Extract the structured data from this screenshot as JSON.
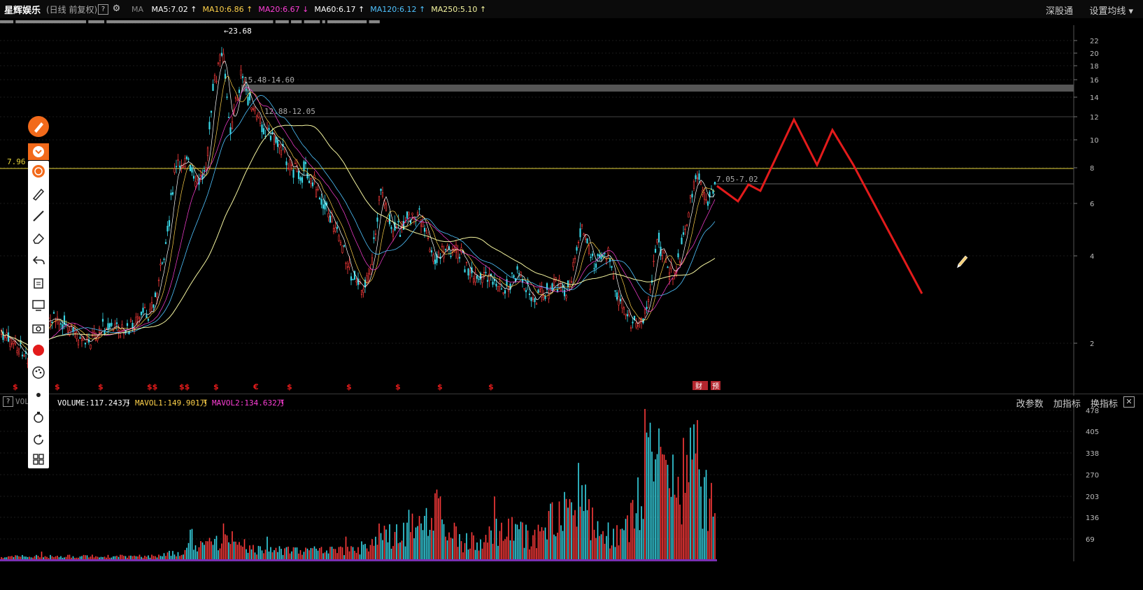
{
  "header": {
    "stock_name": "星辉娱乐",
    "subtitle": "(日线 前复权)",
    "help": "?",
    "ma_label": "MA",
    "ma_values": [
      {
        "text": "MA5:7.02",
        "arrow": "↑",
        "color": "#ffffff"
      },
      {
        "text": "MA10:6.86",
        "arrow": "↑",
        "color": "#ffd24a"
      },
      {
        "text": "MA20:6.67",
        "arrow": "↓",
        "color": "#ff3fd8"
      },
      {
        "text": "MA60:6.17",
        "arrow": "↑",
        "color": "#ffffff"
      },
      {
        "text": "MA120:6.12",
        "arrow": "↑",
        "color": "#4fc3ff"
      },
      {
        "text": "MA250:5.10",
        "arrow": "↑",
        "color": "#f5f5a0"
      }
    ],
    "shen_gu_tong": "深股通",
    "settings": "设置均线",
    "settings_arrow": "▾"
  },
  "ticker_text": "■■■■■ ■■■■■■■■■■■■■■■■■■■■■■■■■■■ ■■■■■■ ■■■■■■■■■■■■■■■■■■■■■■■■■■■■■■■■■■■■■■■■■■■■■■■■■■■■■■■■■■■■■■■■ ■■■■■ ■■■■ ■■■■■■ ■ ■■■■■■■■■■■■■■■ ■■■■",
  "price_chart": {
    "peak_label": "←23.68",
    "zone1_label": "15.48-14.60",
    "zone2_label": "12.88-12.05",
    "zone3_label": "7.05-7.02",
    "hline_label": "7.96",
    "y_ticks": [
      "22",
      "20",
      "18",
      "16",
      "14",
      "12",
      "10",
      "8",
      "6",
      "4",
      "2"
    ],
    "markers": [
      "$",
      "$",
      "$",
      "$$",
      "$$",
      "$",
      "€",
      "$",
      "$",
      "$",
      "$",
      "$"
    ],
    "badge_cai": "财",
    "badge_yu": "预"
  },
  "volume": {
    "help": "?",
    "name": "VOL",
    "volume_text": "VOLUME:117.243万",
    "volume_arrow": "↓",
    "mavol1_text": "MAVOL1:149.901万",
    "mavol1_arrow": "↑",
    "mavol2_text": "MAVOL2:134.632万",
    "mavol2_arrow": "↑",
    "change_params": "改参数",
    "add_indicator": "加指标",
    "switch_indicator": "换指标",
    "close": "✕",
    "y_ticks": [
      "478",
      "405",
      "338",
      "270",
      "203",
      "136",
      "69"
    ]
  },
  "colors": {
    "up": "#ff3b3b",
    "down": "#38d6e6",
    "ma5": "#ffffff",
    "ma10": "#ffd24a",
    "ma20": "#ff3fd8",
    "ma120": "#4fc3ff",
    "ma250": "#f5f5a0",
    "hline": "#e6d33a",
    "drawing": "#e31b1b"
  },
  "toolbar_icons": [
    "draw-pen-icon",
    "collapse-icon",
    "power-icon",
    "pencil-icon",
    "line-icon",
    "eraser-icon",
    "undo-icon",
    "clear-icon",
    "screen-icon",
    "camera-icon",
    "record-icon",
    "palette-icon",
    "dot-icon",
    "magnet-icon",
    "refresh-icon",
    "grid-icon"
  ]
}
